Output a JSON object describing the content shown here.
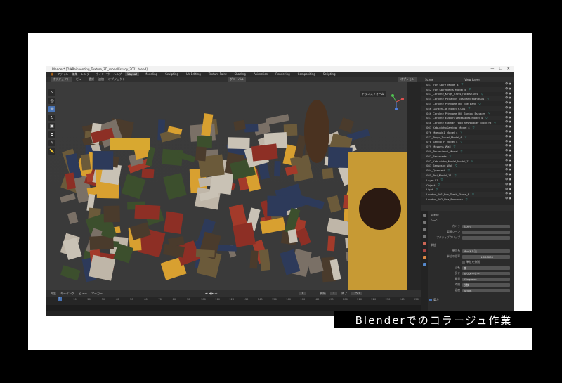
{
  "window": {
    "title": "Blender* [D:¥Reinventing_Texture_3D_model¥study_2021.blend]",
    "controls": [
      "—",
      "☐",
      "✕"
    ]
  },
  "menu": {
    "items": [
      "ファイル",
      "編集",
      "レンダー",
      "ウィンドウ",
      "ヘルプ"
    ],
    "tabs": [
      "Layout",
      "Modeling",
      "Sculpting",
      "UV Editing",
      "Texture Paint",
      "Shading",
      "Animation",
      "Rendering",
      "Compositing",
      "Scripting"
    ],
    "active_tab": "Layout"
  },
  "viewport_header": {
    "mode": "オブジェクト",
    "items": [
      "ビュー",
      "選択",
      "追加",
      "オブジェクト"
    ],
    "orientation": "グローバル",
    "options_label": "オプション"
  },
  "viewport": {
    "transform_label": "トランスフォーム",
    "collage_colors": [
      "#6b5a3a",
      "#a33a2a",
      "#3c4f2d",
      "#bfb6a8",
      "#2d3a5a",
      "#d8a030",
      "#7a7066",
      "#c9c2b5",
      "#4a3b2c",
      "#8d2f25"
    ]
  },
  "timeline": {
    "items": [
      "再生",
      "キーイング",
      "ビュー",
      "マーカー"
    ],
    "current_frame": "1",
    "start_label": "開始",
    "start_value": "1",
    "end_label": "終了",
    "end_value": "250",
    "ruler": [
      "0",
      "10",
      "20",
      "30",
      "40",
      "50",
      "60",
      "70",
      "80",
      "90",
      "100",
      "110",
      "120",
      "130",
      "140",
      "150",
      "160",
      "170",
      "180",
      "190",
      "200",
      "210",
      "220",
      "230",
      "240",
      "250"
    ]
  },
  "outliner": {
    "header_scene": "Scene",
    "header_layer": "View Layer",
    "rows": [
      "041_Iron_Spire_Model_4",
      "042_Iron_SpireFields_Model_5",
      "043_Caroline_Kings_Cross_rubbish.001",
      "044_Caroline_Piccadilly_postcard_stand001",
      "045_Caroline_Primrose_Hill_coe_bark",
      "046_GardenCat_Model_n.001",
      "046_Caroline_Primrose_Hill_Suntap_Escapes",
      "047_Caroline_Euston_vegetables_Model_4",
      "048_Caroline_Fatman_Food_newspaper_block_fit",
      "063_KabukichoKamidai_Model_4",
      "076_Mregain1_Model_4",
      "077_Tokyo_Travel_Model_4",
      "078_Sendai_H_Model_4",
      "079_Mezoms_Wall",
      "080_Tanamimori_Model",
      "081_Berkmade",
      "082_Kabukicho_Model_Model_7",
      "083_Sensoshu_Wall",
      "084_Quantest",
      "085_Tori_Model_11",
      "Layer 01",
      "Object",
      "Light",
      "London_001_Rox_Tomb_Stone_8",
      "London_002_Lisa_Romoose"
    ]
  },
  "properties": {
    "search_placeholder": "",
    "scene_title": "Scene",
    "section_scene": "シーン",
    "camera_label": "カメラ",
    "camera_value": "カメラ",
    "background_scene_label": "背景シーン",
    "active_clip_label": "アクティブクリップ",
    "section_units": "単位",
    "unit_system_label": "単位系",
    "unit_system_value": "メートル法",
    "unit_scale_label": "単位の倍率",
    "unit_scale_value": "1.000000",
    "separate_units_label": "単位を分割",
    "rotation_label": "回転",
    "rotation_value": "度",
    "length_label": "長さ",
    "length_value": "ミリメーター",
    "mass_label": "質量",
    "mass_value": "Kilograms",
    "time_label": "時間",
    "time_value": "秒数",
    "temperature_label": "温度",
    "temperature_value": "Kelvin",
    "section_gravity": "重力"
  },
  "caption": "Blenderでのコラージュ作業"
}
